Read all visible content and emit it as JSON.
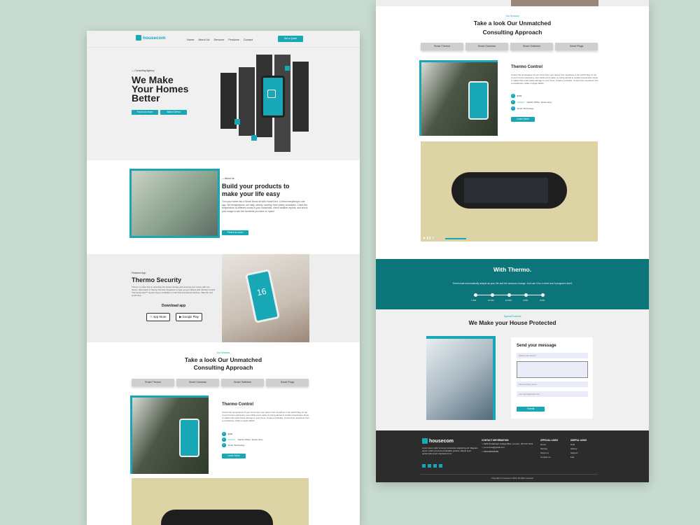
{
  "brand": "housecom",
  "nav": [
    "Home",
    "About Us",
    "Services",
    "Products",
    "Contact"
  ],
  "nav_cta": "Get a Quote",
  "hero": {
    "kicker": "Consulting Agency",
    "title1": "We Make",
    "title2": "Your Homes",
    "title3": "Better",
    "btn1": "Found us more",
    "btn2": "Watch Demo"
  },
  "about": {
    "kicker": "About us",
    "title1": "Build your products to",
    "title2": "make your life easy",
    "body": "Turn your home into a Smart Home all with HouseCom. Control everything in one app. Set temperatures, set daily, weekly, monthly, even yearly schedules. Check the temperature of different rooms in your household, check weather reports, and check your usage to see the hundreds you save on hydro!",
    "btn": "Found us more"
  },
  "featured": {
    "kicker": "Featured App",
    "title": "Thermo Security",
    "body": "There's no other limit to unlocking the perfect climate and securing your house with one device. We'd listed a Thermo Security Integration to help you get started with Climate Control. ThermoSecurity™ System App is available on both iOS and Android devices. Take the next smart step.",
    "download": "Download app",
    "appstore": "App Store",
    "googleplay": "Google Play",
    "phone_temp": "16"
  },
  "services": {
    "kicker": "Our Services",
    "title1": "Take a look Our Unmatched",
    "title2": "Consulting Approach",
    "tabs": [
      "Smart Thermo",
      "Smart Cameras",
      "Smart Switches",
      "Smart Plugs"
    ]
  },
  "product": {
    "title": "Thermo Control",
    "body": "Control the temperature of your home from your device from anywhere in the world! Stay on top of your home's well-being, even while you're away, by being alerted to sudden temperature drops or spikes that could cause damage to your home. Create a schedule. Control from anywhere from a smartphone, tablet or Apple Watch.",
    "price": "$299",
    "colours_label": "Colours:",
    "colours": "Starfire White, Space Grey",
    "feature": "Smart Technology",
    "btn": "Learn More"
  },
  "thermo": {
    "title": "With Thermo.",
    "body": "Thermostat automatically adapts as your life and the seasons change. Just use it for a week and it programs itself.",
    "times": [
      "7 AM",
      "10 AM",
      "12 PM",
      "3 PM",
      "6 PM"
    ]
  },
  "protect": {
    "kicker": "Special Features",
    "title": "We Make your House Protected"
  },
  "form": {
    "title": "Send your message",
    "f1": "What's this about?",
    "f3": "First and last name",
    "f4": "you-name@email.com",
    "submit": "Submit"
  },
  "footer": {
    "about": "Lorem ipsum dolor sit amet consectetur adipisicing elit. Magnam earum nobis commodi ea blanditiis pariatur. Aliquid amet perferendis quod a dignissimos ex.",
    "contact_title": "CONTACT INFORMATION",
    "address": "1929 Panakwaw College Blvd, London, ON M1T 9A3",
    "email": "you-name@gmail.com",
    "phone": "0961484848484",
    "official_title": "OFFICIAL LINKS",
    "official": [
      "Home",
      "Service",
      "About us",
      "Contact us"
    ],
    "useful_title": "USEFUL LINKS",
    "useful": [
      "Help",
      "History",
      "Support",
      "Faq"
    ],
    "copyright": "Copyright by housecom 2020, All rights reserved"
  },
  "colors": {
    "accent": "#17a7b5",
    "dark_teal": "#0c7579",
    "footer": "#2d2c2d",
    "background": "#c7dbd0"
  }
}
